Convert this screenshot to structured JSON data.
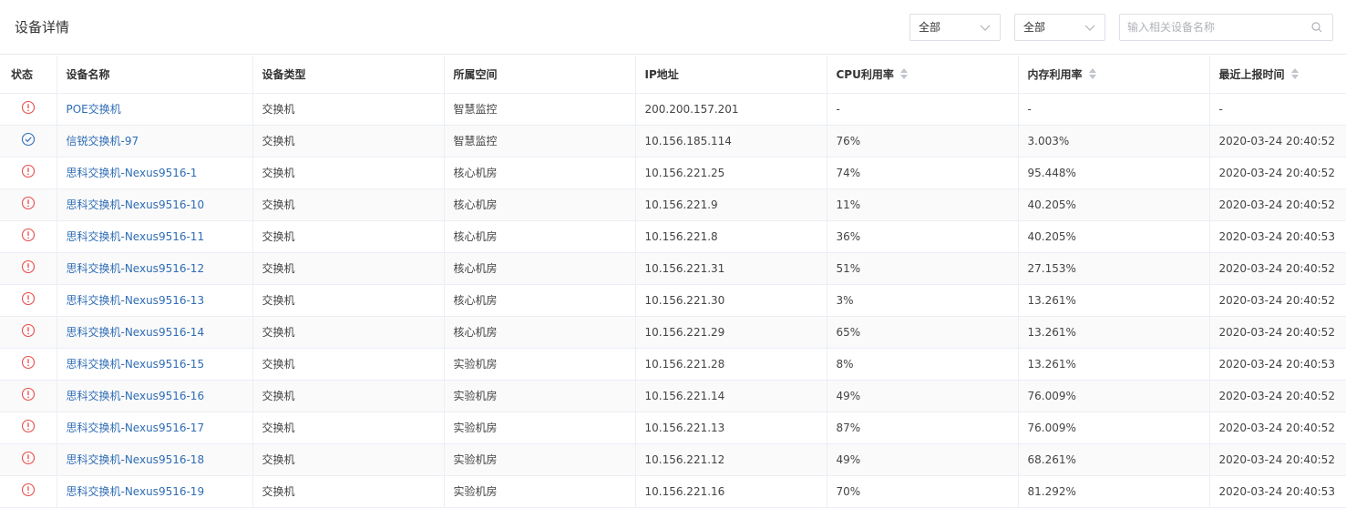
{
  "header": {
    "title": "设备详情",
    "filter1": "全部",
    "filter2": "全部",
    "search_placeholder": "输入相关设备名称"
  },
  "colors": {
    "link": "#2f6db5",
    "alert": "#e84a4a",
    "ok": "#2f6db5"
  },
  "table": {
    "columns": [
      "状态",
      "设备名称",
      "设备类型",
      "所属空间",
      "IP地址",
      "CPU利用率",
      "内存利用率",
      "最近上报时间"
    ],
    "rows": [
      {
        "status": "alert",
        "name": "POE交换机",
        "type": "交换机",
        "space": "智慧监控",
        "ip": "200.200.157.201",
        "cpu": "-",
        "mem": "-",
        "time": "-"
      },
      {
        "status": "ok",
        "name": "信锐交换机-97",
        "type": "交换机",
        "space": "智慧监控",
        "ip": "10.156.185.114",
        "cpu": "76%",
        "mem": "3.003%",
        "time": "2020-03-24 20:40:52"
      },
      {
        "status": "alert",
        "name": "思科交换机-Nexus9516-1",
        "type": "交换机",
        "space": "核心机房",
        "ip": "10.156.221.25",
        "cpu": "74%",
        "mem": "95.448%",
        "time": "2020-03-24 20:40:52"
      },
      {
        "status": "alert",
        "name": "思科交换机-Nexus9516-10",
        "type": "交换机",
        "space": "核心机房",
        "ip": "10.156.221.9",
        "cpu": "11%",
        "mem": "40.205%",
        "time": "2020-03-24 20:40:52"
      },
      {
        "status": "alert",
        "name": "思科交换机-Nexus9516-11",
        "type": "交换机",
        "space": "核心机房",
        "ip": "10.156.221.8",
        "cpu": "36%",
        "mem": "40.205%",
        "time": "2020-03-24 20:40:53"
      },
      {
        "status": "alert",
        "name": "思科交换机-Nexus9516-12",
        "type": "交换机",
        "space": "核心机房",
        "ip": "10.156.221.31",
        "cpu": "51%",
        "mem": "27.153%",
        "time": "2020-03-24 20:40:52"
      },
      {
        "status": "alert",
        "name": "思科交换机-Nexus9516-13",
        "type": "交换机",
        "space": "核心机房",
        "ip": "10.156.221.30",
        "cpu": "3%",
        "mem": "13.261%",
        "time": "2020-03-24 20:40:52"
      },
      {
        "status": "alert",
        "name": "思科交换机-Nexus9516-14",
        "type": "交换机",
        "space": "核心机房",
        "ip": "10.156.221.29",
        "cpu": "65%",
        "mem": "13.261%",
        "time": "2020-03-24 20:40:52"
      },
      {
        "status": "alert",
        "name": "思科交换机-Nexus9516-15",
        "type": "交换机",
        "space": "实验机房",
        "ip": "10.156.221.28",
        "cpu": "8%",
        "mem": "13.261%",
        "time": "2020-03-24 20:40:53"
      },
      {
        "status": "alert",
        "name": "思科交换机-Nexus9516-16",
        "type": "交换机",
        "space": "实验机房",
        "ip": "10.156.221.14",
        "cpu": "49%",
        "mem": "76.009%",
        "time": "2020-03-24 20:40:52"
      },
      {
        "status": "alert",
        "name": "思科交换机-Nexus9516-17",
        "type": "交换机",
        "space": "实验机房",
        "ip": "10.156.221.13",
        "cpu": "87%",
        "mem": "76.009%",
        "time": "2020-03-24 20:40:52"
      },
      {
        "status": "alert",
        "name": "思科交换机-Nexus9516-18",
        "type": "交换机",
        "space": "实验机房",
        "ip": "10.156.221.12",
        "cpu": "49%",
        "mem": "68.261%",
        "time": "2020-03-24 20:40:52"
      },
      {
        "status": "alert",
        "name": "思科交换机-Nexus9516-19",
        "type": "交换机",
        "space": "实验机房",
        "ip": "10.156.221.16",
        "cpu": "70%",
        "mem": "81.292%",
        "time": "2020-03-24 20:40:53"
      }
    ]
  }
}
